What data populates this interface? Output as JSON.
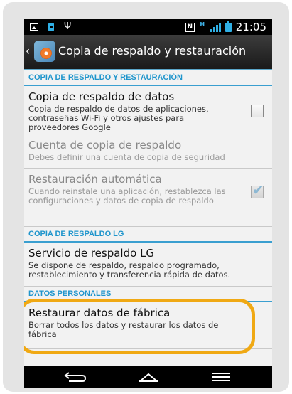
{
  "status_bar": {
    "time": "21:05",
    "icons": [
      "image-icon",
      "shopping-bag-icon",
      "usb-icon",
      "nfc-icon",
      "h-plus-icon",
      "signal-icon",
      "battery-icon"
    ],
    "nfc_label": "N",
    "h_label": "H"
  },
  "action_bar": {
    "title": "Copia de respaldo y restauración"
  },
  "sections": {
    "backup_restore": "COPIA DE RESPALDO Y RESTAURACIÓN",
    "lg_backup": "COPIA DE RESPALDO LG",
    "personal_data": "DATOS PERSONALES"
  },
  "items": {
    "backup_data": {
      "title": "Copia de respaldo de datos",
      "summary": "Copia de respaldo de datos de aplicaciones, contraseñas Wi-Fi y otros ajustes para proveedores Google",
      "checked": false
    },
    "backup_account": {
      "title": "Cuenta de copia de respaldo",
      "summary": "Debes definir una cuenta de copia de seguridad"
    },
    "auto_restore": {
      "title": "Restauración automática",
      "summary": "Cuando reinstale una aplicación, restablezca las configuraciones y datos de copia de respaldo",
      "checked": true
    },
    "lg_service": {
      "title": "Servicio de respaldo LG",
      "summary": "Se dispone de respaldo, respaldo programado, restablecimiento y transferencia rápida de datos."
    },
    "factory_reset": {
      "title": "Restaurar datos de fábrica",
      "summary": "Borrar todos los datos y restaurar los datos de fábrica"
    }
  },
  "colors": {
    "accent": "#1f95cc",
    "highlight": "#f0a914",
    "status_icons": "#2fb0e6"
  },
  "nav_bar": {
    "icons": [
      "back-icon",
      "home-icon",
      "menu-icon"
    ]
  }
}
